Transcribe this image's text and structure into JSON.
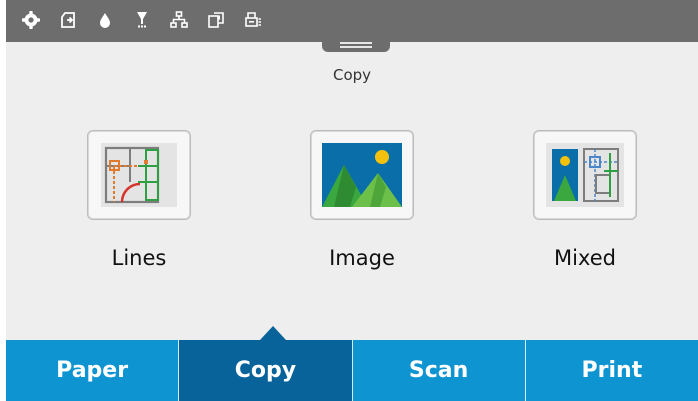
{
  "status_bar": {
    "icons": [
      "gear-icon",
      "media-load-icon",
      "ink-drop-icon",
      "printhead-icon",
      "network-icon",
      "copy-status-icon",
      "printer-queue-icon"
    ]
  },
  "page": {
    "title": "Copy"
  },
  "options": [
    {
      "label": "Lines"
    },
    {
      "label": "Image"
    },
    {
      "label": "Mixed"
    }
  ],
  "tabs": [
    {
      "label": "Paper"
    },
    {
      "label": "Copy",
      "active": true
    },
    {
      "label": "Scan"
    },
    {
      "label": "Print"
    }
  ],
  "colors": {
    "tab": "#0f94d2",
    "tab_active": "#07639a",
    "status_bar": "#6d6d6d",
    "background": "#eeeeee"
  }
}
